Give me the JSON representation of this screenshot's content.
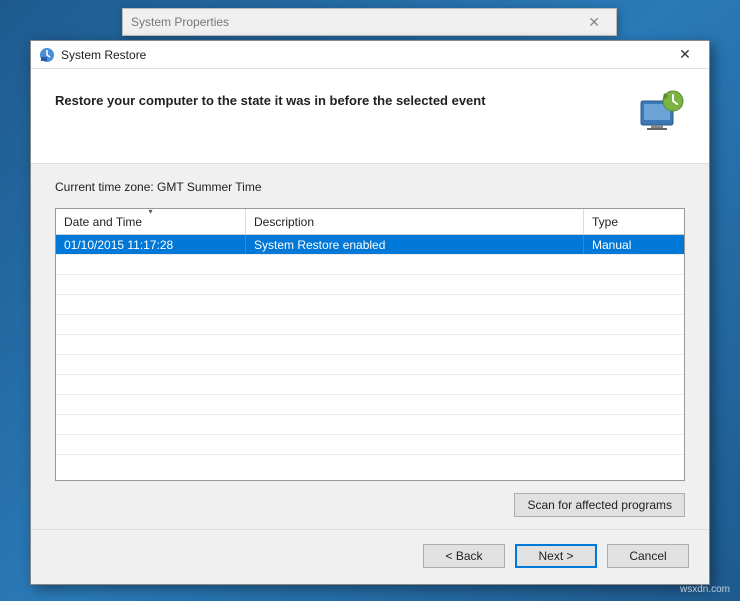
{
  "background_window": {
    "title": "System Properties"
  },
  "dialog": {
    "title": "System Restore",
    "header": "Restore your computer to the state it was in before the selected event",
    "timezone_label": "Current time zone: GMT Summer Time",
    "columns": {
      "date_time": "Date and Time",
      "description": "Description",
      "type": "Type"
    },
    "rows": [
      {
        "date_time": "01/10/2015 11:17:28",
        "description": "System Restore enabled",
        "type": "Manual",
        "selected": true
      }
    ],
    "buttons": {
      "scan": "Scan for affected programs",
      "back": "< Back",
      "next": "Next >",
      "cancel": "Cancel"
    }
  },
  "watermark": "wsxdn.com"
}
